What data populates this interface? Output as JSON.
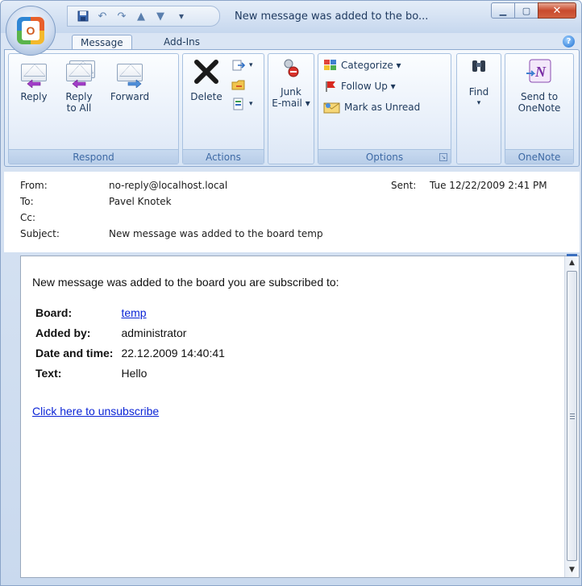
{
  "window": {
    "title": "New message was added to the bo...",
    "orb_letter": "O"
  },
  "tabs": [
    {
      "label": "Message",
      "active": true
    },
    {
      "label": "Add-Ins",
      "active": false
    }
  ],
  "ribbon": {
    "respond": {
      "label": "Respond",
      "reply": "Reply",
      "reply_all_line1": "Reply",
      "reply_all_line2": "to All",
      "forward": "Forward"
    },
    "actions": {
      "label": "Actions",
      "delete": "Delete"
    },
    "junk": {
      "line1": "Junk",
      "line2": "E-mail ▾"
    },
    "options": {
      "label": "Options",
      "categorize": "Categorize ▾",
      "follow_up": "Follow Up ▾",
      "mark_unread": "Mark as Unread"
    },
    "find": {
      "label": "Find",
      "arrow": "▾"
    },
    "onenote": {
      "label": "OneNote",
      "line1": "Send to",
      "line2": "OneNote"
    }
  },
  "header": {
    "from_label": "From:",
    "from_value": "no-reply@localhost.local",
    "to_label": "To:",
    "to_value": "Pavel Knotek",
    "cc_label": "Cc:",
    "cc_value": "",
    "subject_label": "Subject:",
    "subject_value": "New message was added to the board temp",
    "sent_label": "Sent:",
    "sent_value": "Tue 12/22/2009 2:41 PM"
  },
  "message": {
    "intro": "New message was added to the board you are subscribed to:",
    "rows": [
      {
        "key": "Board:",
        "value": "temp",
        "link": true
      },
      {
        "key": "Added by:",
        "value": "administrator",
        "link": false
      },
      {
        "key": "Date and time:",
        "value": "22.12.2009 14:40:41",
        "link": false
      },
      {
        "key": "Text:",
        "value": "Hello",
        "link": false
      }
    ],
    "unsubscribe": "Click here to unsubscribe"
  },
  "colors": {
    "link": "#0b24d6",
    "ribbon_label": "#3e6aa5",
    "close_button": "#c84a2d"
  }
}
